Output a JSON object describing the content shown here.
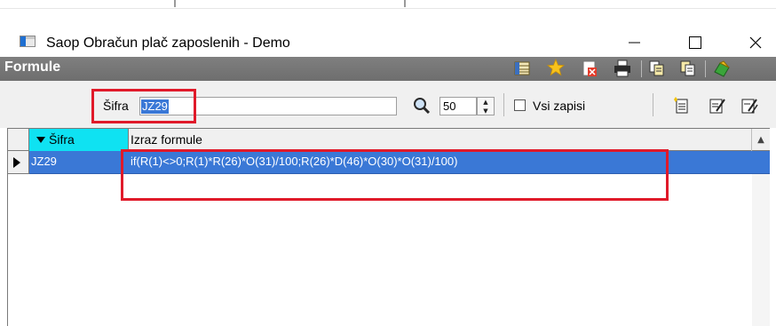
{
  "window": {
    "title": "Saop Obračun plač zaposlenih - Demo"
  },
  "panel": {
    "title": "Formule"
  },
  "search": {
    "label": "Šifra",
    "value": "JZ29",
    "count": "50",
    "all_records_label": "Vsi zapisi"
  },
  "grid": {
    "columns": [
      "Šifra",
      "Izraz formule"
    ],
    "rows": [
      {
        "sifra": "JZ29",
        "izraz": "if(R(1)<>0;R(1)*R(26)*O(31)/100;R(26)*D(46)*O(30)*O(31)/100)"
      }
    ]
  },
  "colors": {
    "selection": "#3a78d6",
    "header_active": "#0fe2f2",
    "annotation": "#e01a2a",
    "band": "#7a7a7a"
  },
  "icons": {
    "app": "app-window-icon",
    "minimize": "minimize-icon",
    "maximize": "maximize-icon",
    "close": "close-icon",
    "toolbar_top": [
      "columns-icon",
      "favorite-star-icon",
      "delete-record-icon",
      "print-icon",
      "copy-icon",
      "paste-icon",
      "exit-icon"
    ],
    "search": "magnifier-icon",
    "toolbar_right": [
      "new-document-icon",
      "edit-icon",
      "edit-multiple-icon"
    ]
  }
}
